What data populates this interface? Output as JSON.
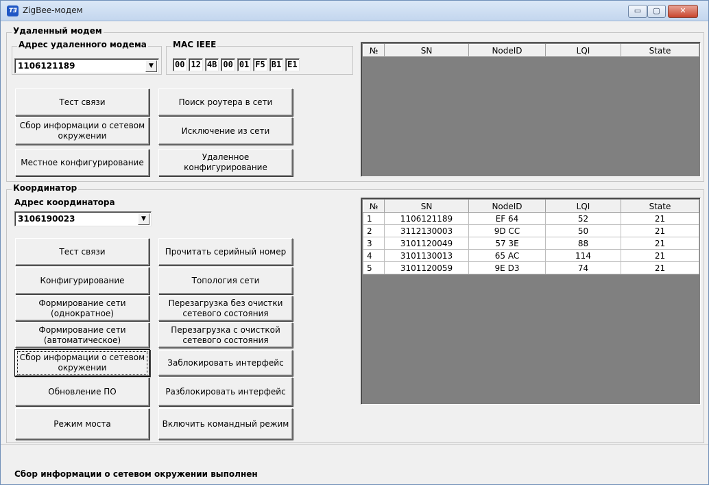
{
  "window": {
    "title": "ZigBee-модем",
    "min_glyph": "▭",
    "max_glyph": "▢",
    "close_glyph": "✕"
  },
  "remote": {
    "group_label": "Удаленный модем",
    "address_label": "Адрес удаленного модема",
    "address_value": "1106121189",
    "mac_label": "MAC IEEE",
    "mac": [
      "00",
      "12",
      "4B",
      "00",
      "01",
      "F5",
      "B1",
      "E1"
    ],
    "buttons": {
      "test": "Тест связи",
      "find_router": "Поиск роутера в сети",
      "collect_info": "Сбор информации о сетевом окружении",
      "exclude": "Исключение из сети",
      "local_config": "Местное конфигурирование",
      "remote_config": "Удаленное конфигурирование"
    },
    "table": {
      "headers": [
        "№",
        "SN",
        "NodeID",
        "LQI",
        "State"
      ],
      "rows": []
    }
  },
  "coordinator": {
    "group_label": "Координатор",
    "address_label": "Адрес координатора",
    "address_value": "3106190023",
    "buttons": {
      "test": "Тест связи",
      "read_serial": "Прочитать серийный номер",
      "configure": "Конфигурирование",
      "topology": "Топология сети",
      "form_once": "Формирование сети (однократное)",
      "reboot_no_clear": "Перезагрузка без очистки сетевого состояния",
      "form_auto": "Формирование сети (автоматическое)",
      "reboot_clear": "Перезагрузка с очисткой сетевого состояния",
      "collect_info": "Сбор информации о сетевом окружении",
      "lock_iface": "Заблокировать интерфейс",
      "update_fw": "Обновление ПО",
      "unlock_iface": "Разблокировать интерфейс",
      "bridge_mode": "Режим моста",
      "command_mode": "Включить командный режим"
    },
    "table": {
      "headers": [
        "№",
        "SN",
        "NodeID",
        "LQI",
        "State"
      ],
      "rows": [
        [
          "1",
          "1106121189",
          "EF 64",
          "52",
          "21"
        ],
        [
          "2",
          "3112130003",
          "9D CC",
          "50",
          "21"
        ],
        [
          "3",
          "3101120049",
          "57 3E",
          "88",
          "21"
        ],
        [
          "4",
          "3101130013",
          "65 AC",
          "114",
          "21"
        ],
        [
          "5",
          "3101120059",
          "9E D3",
          "74",
          "21"
        ]
      ]
    }
  },
  "status": {
    "message": "Сбор информации о сетевом окружении выполнен"
  }
}
